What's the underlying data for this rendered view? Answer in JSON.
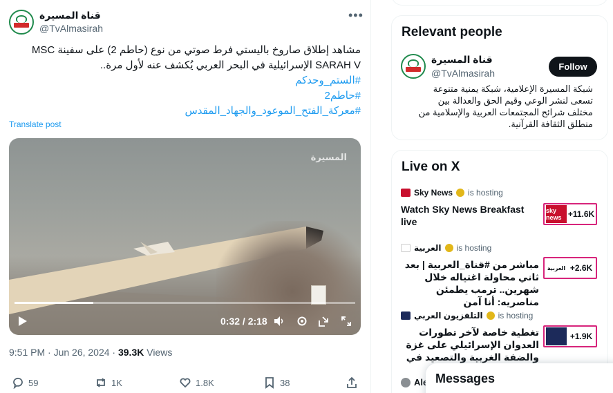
{
  "post": {
    "author_name": "قناة المسيرة",
    "author_handle": "@TvAlmasirah",
    "text_line1": "مشاهد إطلاق صاروخ باليستي فرط صوتي من نوع (حاطم 2) على سفينة MSC",
    "text_line2": "SARAH V الإسرائيلية في البحر العربي يُكشف عنه لأول مرة..",
    "hashtags": [
      "#الستم_وحدكم",
      "#حاطم2",
      "#معركة_الفتح_الموعود_والجهاد_المقدس"
    ],
    "translate_label": "Translate post",
    "video_watermark": "المسيرة",
    "video_time": "0:32 / 2:18",
    "video_progress_fraction": 0.232,
    "timestamp": "9:51 PM · Jun 26, 2024 · ",
    "views_count": "39.3K",
    "views_label": " Views",
    "actions": {
      "replies": "59",
      "reposts": "1K",
      "likes": "1.8K",
      "bookmarks": "38"
    }
  },
  "relevant_people": {
    "heading": "Relevant people",
    "name": "قناة المسيرة",
    "handle": "@TvAlmasirah",
    "follow_label": "Follow",
    "bio": "شبكة المسيرة الإعلامية، شبكة يمنية متنوعة تسعى لنشر الوعي وقيم الحق والعدالة بين مختلف شرائح المجتمعات العربية والإسلامية من منطلق الثقافة القرآنية."
  },
  "live": {
    "heading": "Live on X",
    "items": [
      {
        "host": "Sky News",
        "hosting_label": "is hosting",
        "title": "Watch Sky News Breakfast live",
        "count": "+11.6K",
        "logo_text": "sky news",
        "logo_color": "#c8102e"
      },
      {
        "host": "العربية",
        "hosting_label": "is hosting",
        "title": "مباشر من #قناة_العربية | بعد ثاني محاولة اغتياله خلال شهرين.. ترمب يطمئن مناصريه: أنا آمن",
        "count": "+2.6K",
        "logo_text": "العربية",
        "logo_color": "#ffffff"
      },
      {
        "host": "التلفزيون العربي",
        "hosting_label": "is hosting",
        "title": "تغطية خاصة لآخر تطورات العدوان الإسرائيلي على غزة والضفة الغربية والتصعيد في جنوب لبنان",
        "count": "+1.9K",
        "logo_text": "",
        "logo_color": "#1c2a5a"
      }
    ],
    "peek_name": "Ale"
  },
  "messages_label": "Messages",
  "colors": {
    "accent": "#1d9bf0",
    "brand_green": "#1f8a4c",
    "live_border": "#d7247b"
  }
}
